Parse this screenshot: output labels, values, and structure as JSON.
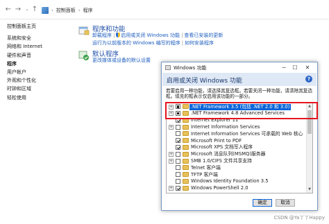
{
  "breadcrumb": {
    "items": [
      "控制面板",
      "程序"
    ],
    "separator": "›"
  },
  "left_nav": {
    "home": "控制面板主页",
    "items": [
      "系统和安全",
      "网络和 Internet",
      "硬件和声音",
      "程序",
      "用户帐户",
      "外观和个性化",
      "时钟和区域",
      "轻松使用"
    ],
    "current_index": 3
  },
  "categories": [
    {
      "title": "程序和功能",
      "links_line1": [
        "卸载程序",
        "启用或关闭 Windows 功能",
        "查看已安装的更新"
      ],
      "links_line2": [
        "运行为以前版本的 Windows 编写的程序",
        "如何安装程序"
      ],
      "icon": "programs-icon"
    },
    {
      "title": "默认程序",
      "links_line1": [
        "更改媒体或设备的默认设置"
      ],
      "icon": "default-programs-icon"
    }
  ],
  "dialog": {
    "window_title": "Windows 功能",
    "heading": "启用或关闭 Windows 功能",
    "help_label": "?",
    "description": "若要启用一种功能，请选择其复选框。若要关闭一种功能，请清除其复选框。填充的框表示仅启用该功能的一部分。",
    "features": [
      {
        "label": ".NET Framework 3.5 (包括 .NET 2.0 和 3.0)",
        "state": "partial",
        "expandable": true,
        "selected": true
      },
      {
        "label": ".NET Framework 4.8 Advanced Services",
        "state": "partial",
        "expandable": true,
        "selected": false
      },
      {
        "label": "Internet Explorer 11",
        "state": "checked",
        "expandable": false,
        "selected": false
      },
      {
        "label": "Internet Information Services",
        "state": "unchecked",
        "expandable": true,
        "selected": false
      },
      {
        "label": "Internet Information Services 可承载的 Web 核心",
        "state": "unchecked",
        "expandable": false,
        "selected": false
      },
      {
        "label": "Microsoft Print to PDF",
        "state": "checked",
        "expandable": false,
        "selected": false
      },
      {
        "label": "Microsoft XPS 文档写入程序",
        "state": "checked",
        "expandable": false,
        "selected": false
      },
      {
        "label": "Microsoft 消息队列(MSMQ)服务器",
        "state": "unchecked",
        "expandable": true,
        "selected": false
      },
      {
        "label": "SMB 1.0/CIFS 文件共享支持",
        "state": "unchecked",
        "expandable": true,
        "selected": false
      },
      {
        "label": "Telnet 客户端",
        "state": "unchecked",
        "expandable": false,
        "selected": false
      },
      {
        "label": "TFTP 客户端",
        "state": "unchecked",
        "expandable": false,
        "selected": false
      },
      {
        "label": "Windows Identity Foundation 3.5",
        "state": "unchecked",
        "expandable": false,
        "selected": false
      },
      {
        "label": "Windows PowerShell 2.0",
        "state": "checked",
        "expandable": true,
        "selected": false
      }
    ],
    "ok_label": "确定",
    "cancel_label": "取消"
  },
  "highlight_color": "#e4151f",
  "accent_color": "#0a64d8",
  "watermark": "CSDN @Ya丫丫Happy"
}
